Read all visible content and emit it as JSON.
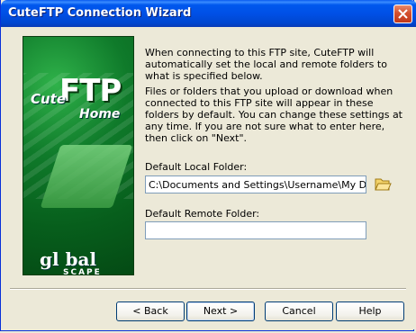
{
  "window": {
    "title": "CuteFTP Connection Wizard"
  },
  "intro": {
    "paragraph1": "When connecting to this FTP site, CuteFTP will automatically set the local and remote folders to what is specified below.",
    "paragraph2": "Files or folders that you upload or download when connected to this FTP site will appear in these folders by default. You can change these settings at any time. If you are not sure what to enter here, then click on \"Next\"."
  },
  "side_image": {
    "logo_cute": "Cute",
    "logo_ftp": "FTP",
    "logo_home": "Home",
    "brand_global": "gl bal",
    "brand_scape": "SCAPE"
  },
  "local_folder": {
    "label": "Default Local Folder:",
    "value": "C:\\Documents and Settings\\Username\\My Documents",
    "browse_icon": "folder-open-icon"
  },
  "remote_folder": {
    "label": "Default Remote Folder:",
    "value": ""
  },
  "buttons": {
    "back": "< Back",
    "next": "Next >",
    "cancel": "Cancel",
    "help": "Help"
  },
  "colors": {
    "titlebar": "#0054e3",
    "close_button": "#d4502e",
    "dialog_bg": "#ece9d8",
    "brand_green": "#0f7a2a"
  }
}
